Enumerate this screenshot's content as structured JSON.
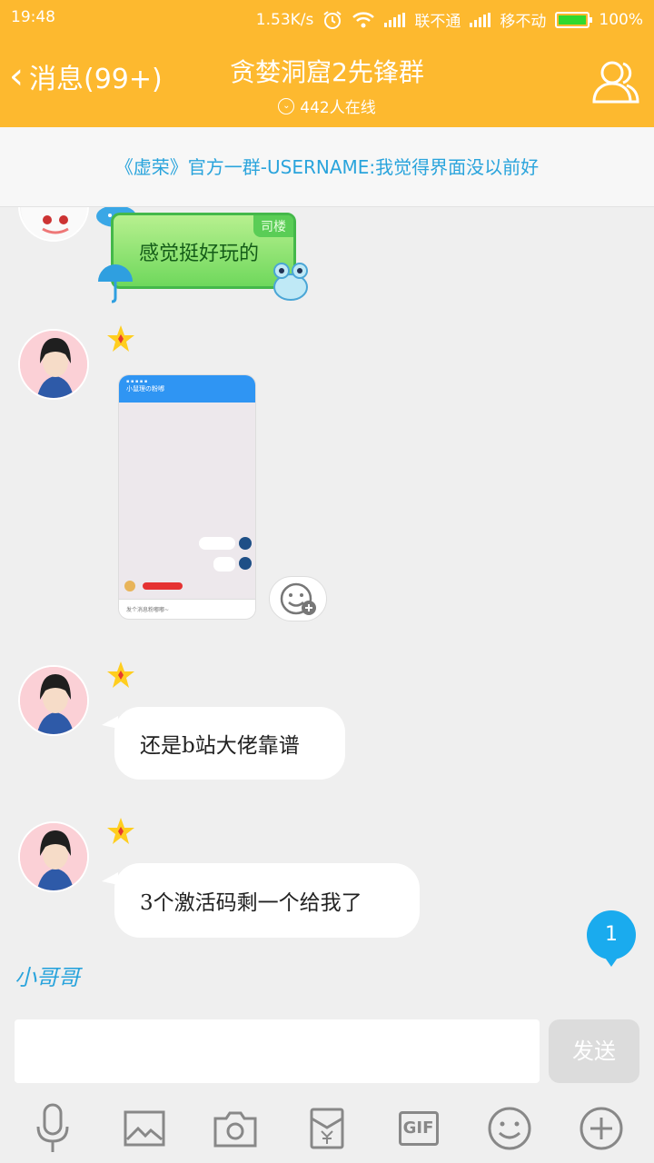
{
  "status_bar": {
    "time": "19:48",
    "speed": "1.53K/s",
    "carrier1": "联不通",
    "carrier2": "移不动",
    "battery": "100%"
  },
  "header": {
    "back_label": "消息(99+)",
    "title": "贪婪洞窟2先锋群",
    "online": "442人在线",
    "members_icon": "group-members-icon"
  },
  "notice": {
    "text": "《虚荣》官方一群-USERNAME:我觉得界面没以前好"
  },
  "messages": [
    {
      "text": "感觉挺好玩的",
      "tag": "司楼"
    },
    {
      "type": "image",
      "screenshot_title": "小鼠理の粉嘟",
      "screenshot_input": "发个消息粉嘟嘟~"
    },
    {
      "text": "还是b站大佬靠谱"
    },
    {
      "text": "3个激活码剩一个给我了"
    }
  ],
  "unread_count": "1",
  "partial_name": "小哥哥",
  "input": {
    "placeholder": "",
    "send_label": "发送"
  },
  "toolbar": {
    "icons": [
      "microphone-icon",
      "image-icon",
      "camera-icon",
      "red-packet-icon",
      "gif-icon",
      "emoji-icon",
      "plus-icon"
    ],
    "gif_label": "GIF"
  },
  "colors": {
    "header_bg": "#fdb92f",
    "notice_text": "#2aa4dc",
    "unread_badge": "#1aabee"
  }
}
